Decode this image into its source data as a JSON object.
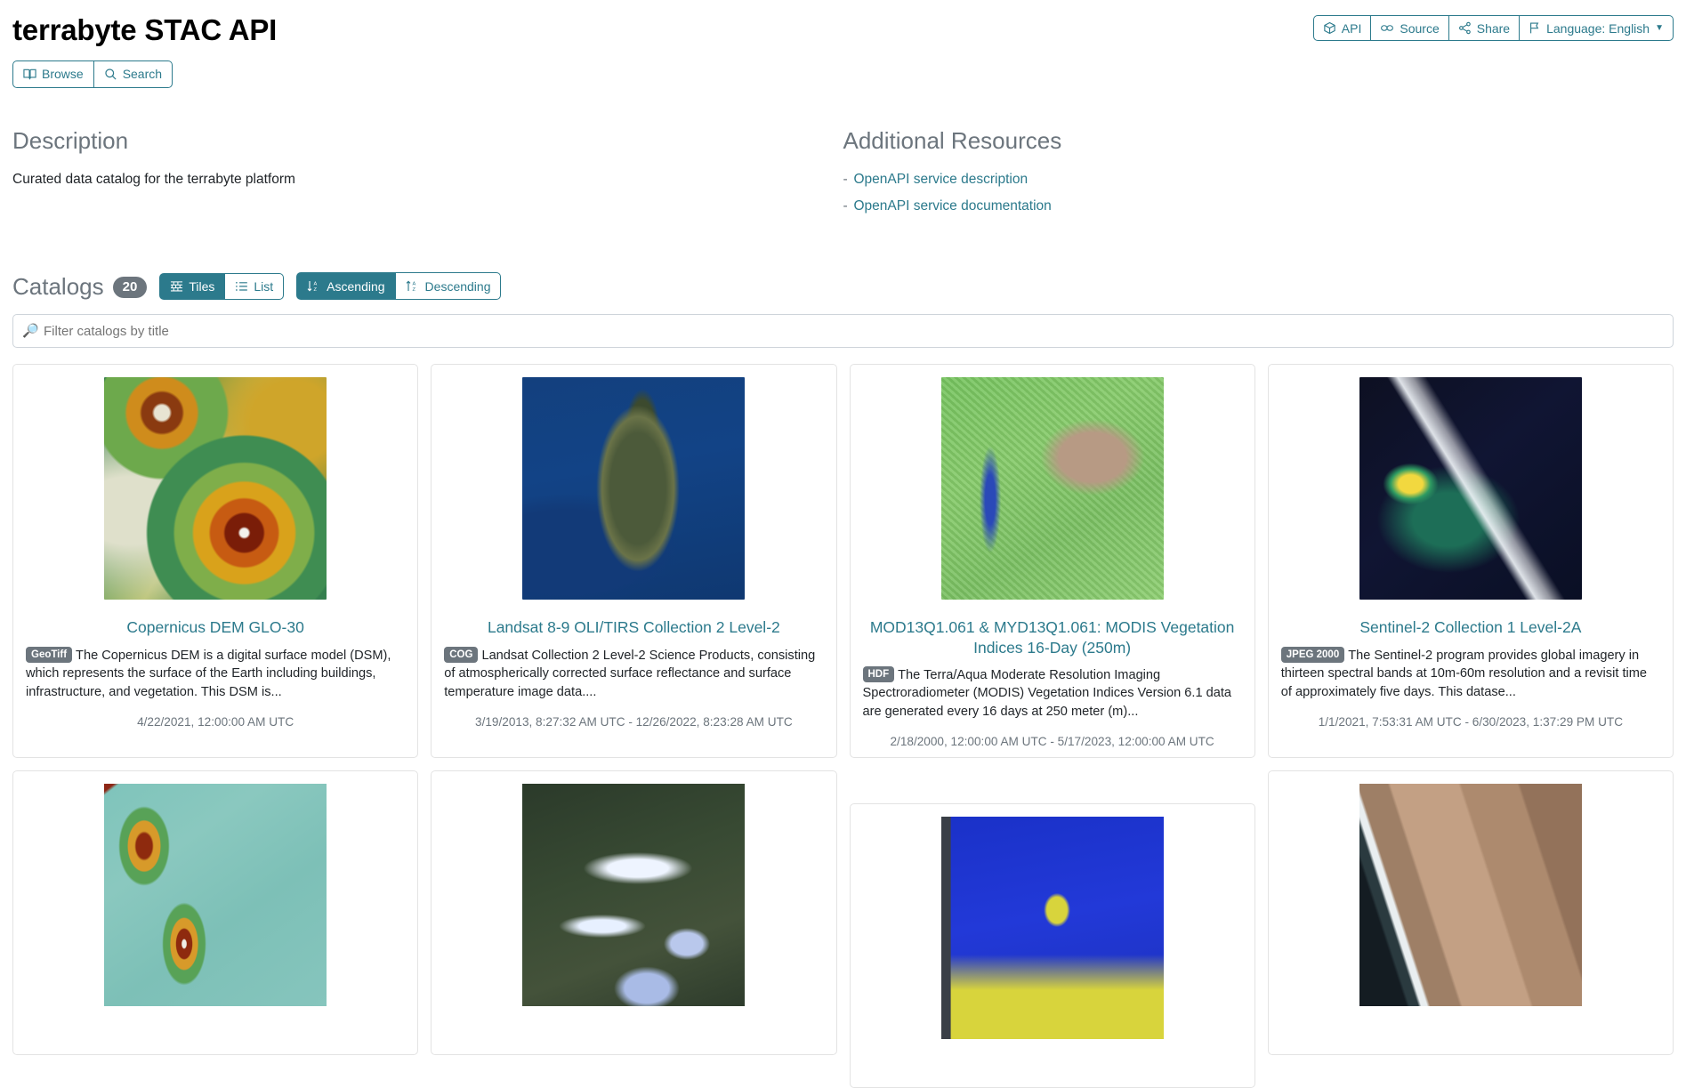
{
  "header": {
    "title": "terrabyte STAC API",
    "nav_buttons": [
      {
        "label": "Browse",
        "icon": "book-icon"
      },
      {
        "label": "Search",
        "icon": "search-icon"
      }
    ],
    "tools": [
      {
        "label": "API",
        "icon": "cube-icon"
      },
      {
        "label": "Source",
        "icon": "link-icon"
      },
      {
        "label": "Share",
        "icon": "share-icon"
      },
      {
        "label": "Language: English",
        "icon": "flag-icon"
      }
    ]
  },
  "description": {
    "heading": "Description",
    "text": "Curated data catalog for the terrabyte platform"
  },
  "resources": {
    "heading": "Additional Resources",
    "bullet": "-",
    "links": [
      "OpenAPI service description",
      "OpenAPI service documentation"
    ]
  },
  "catalogs": {
    "heading": "Catalogs",
    "count": "20",
    "view_toggle": [
      {
        "label": "Tiles",
        "icon": "tiles-icon",
        "active": true
      },
      {
        "label": "List",
        "icon": "list-icon",
        "active": false
      }
    ],
    "sort_toggle": [
      {
        "label": "Ascending",
        "icon": "sort-asc-icon",
        "active": true
      },
      {
        "label": "Descending",
        "icon": "sort-desc-icon",
        "active": false
      }
    ],
    "filter_placeholder": "Filter catalogs by title",
    "filter_value": "",
    "filter_icon": "🔎"
  },
  "cards": [
    {
      "title": "Copernicus DEM GLO-30",
      "badge": "GeoTiff",
      "body": "The Copernicus DEM is a digital surface model (DSM), which represents the surface of the Earth including buildings, infrastructure, and vegetation. This DSM is...",
      "date": "4/22/2021, 12:00:00 AM UTC",
      "thumb": "t-dem1"
    },
    {
      "title": "Landsat 8-9 OLI/TIRS Collection 2 Level-2",
      "badge": "COG",
      "body": "Landsat Collection 2 Level-2 Science Products, consisting of atmospherically corrected surface reflectance and surface temperature image data....",
      "date": "3/19/2013, 8:27:32 AM UTC - 12/26/2022, 8:23:28 AM UTC",
      "thumb": "t-sat-corsica"
    },
    {
      "title": "MOD13Q1.061 & MYD13Q1.061: MODIS Vegetation Indices 16-Day (250m)",
      "badge": "HDF",
      "body": "The Terra/Aqua Moderate Resolution Imaging Spectroradiometer (MODIS) Vegetation Indices Version 6.1 data are generated every 16 days at 250 meter (m)...",
      "date": "2/18/2000, 12:00:00 AM UTC - 5/17/2023, 12:00:00 AM UTC",
      "thumb": "t-modis"
    },
    {
      "title": "Sentinel-2 Collection 1 Level-2A",
      "badge": "JPEG 2000",
      "body": "The Sentinel-2 program provides global imagery in thirteen spectral bands at 10m-60m resolution and a revisit time of approximately five days. This datase...",
      "date": "1/1/2021, 7:53:31 AM UTC - 6/30/2023, 1:37:29 PM UTC",
      "thumb": "t-plume"
    }
  ],
  "cards_row2": [
    {
      "thumb": "t-dem2",
      "offset": false
    },
    {
      "thumb": "t-alps",
      "offset": false
    },
    {
      "thumb": "t-blueyellow",
      "offset": true
    },
    {
      "thumb": "t-coast",
      "offset": false
    }
  ],
  "colors": {
    "accent": "#2c7a8c",
    "muted": "#6c757d",
    "border": "#e3e3e3"
  }
}
